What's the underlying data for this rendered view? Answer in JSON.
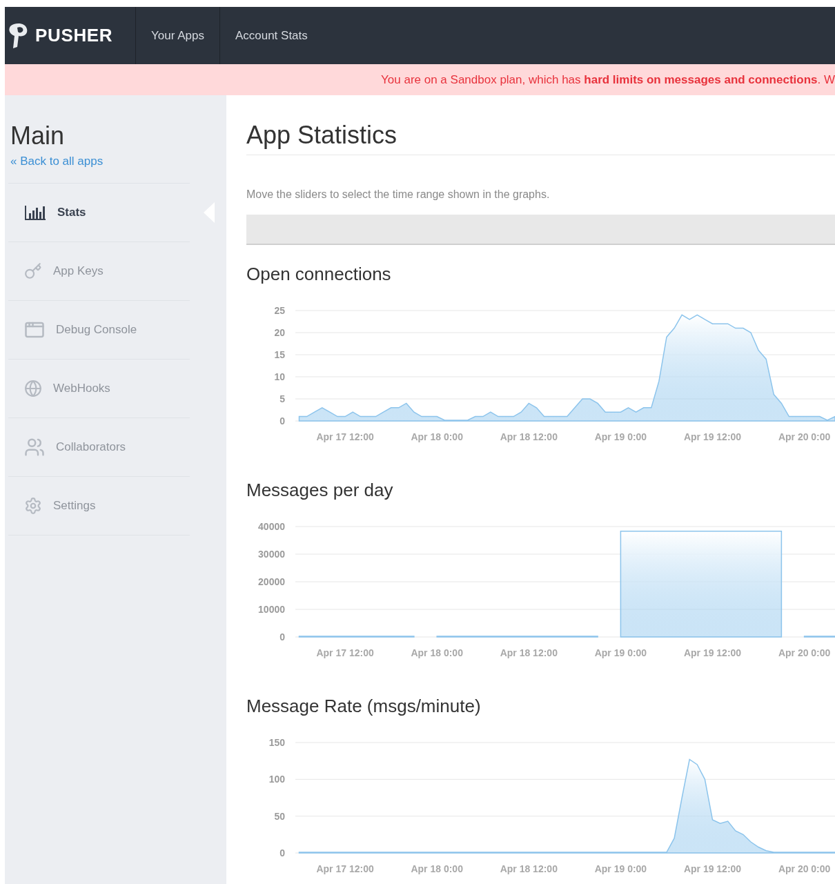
{
  "nav": {
    "brand": "PUSHER",
    "items": [
      {
        "label": "Your Apps",
        "selected": false
      },
      {
        "label": "Account Stats",
        "selected": false
      }
    ]
  },
  "banner": {
    "text": "You are on a Sandbox plan, which has **hard limits on messages and connections**. W"
  },
  "sidebar": {
    "title": "Main",
    "back_link": "« Back to all apps",
    "items": [
      {
        "label": "Stats",
        "kind": "stats",
        "selected": true
      },
      {
        "label": "App Keys",
        "kind": "keys",
        "selected": false
      },
      {
        "label": "Debug Console",
        "kind": "console",
        "selected": false
      },
      {
        "label": "WebHooks",
        "kind": "webhooks",
        "selected": false
      },
      {
        "label": "Collaborators",
        "kind": "collaborators",
        "selected": false
      },
      {
        "label": "Settings",
        "kind": "settings",
        "selected": false
      }
    ]
  },
  "main": {
    "title": "App Statistics",
    "hint": "Move the sliders to select the time range shown in the graphs.",
    "charts": [
      {
        "title": "Open connections",
        "chart_data": {
          "type": "area",
          "categories": [
            null,
            null,
            null,
            null,
            null,
            null,
            "Apr 17 12:00",
            null,
            null,
            null,
            null,
            null,
            null,
            null,
            null,
            null,
            null,
            null,
            "Apr 18 0:00",
            null,
            null,
            null,
            null,
            null,
            null,
            null,
            null,
            null,
            null,
            null,
            "Apr 18 12:00",
            null,
            null,
            null,
            null,
            null,
            null,
            null,
            null,
            null,
            null,
            null,
            "Apr 19 0:00",
            null,
            null,
            null,
            null,
            null,
            null,
            null,
            null,
            null,
            null,
            null,
            "Apr 19 12:00",
            null,
            null,
            null,
            null,
            null,
            null,
            null,
            null,
            null,
            null,
            null,
            "Apr 20 0:00",
            null,
            null,
            null,
            null
          ],
          "series": [
            {
              "color": "#8cc4ec",
              "values": [
                1,
                1,
                2,
                3,
                2,
                1,
                1,
                2,
                1,
                1,
                1,
                2,
                3,
                3,
                4,
                2,
                1,
                1,
                1,
                0,
                0,
                0,
                0,
                1,
                1,
                2,
                1,
                1,
                1,
                2,
                4,
                3,
                1,
                1,
                1,
                1,
                3,
                5,
                5,
                4,
                2,
                2,
                2,
                3,
                2,
                3,
                3,
                9,
                19,
                21,
                24,
                23,
                24,
                23,
                22,
                22,
                22,
                21,
                21,
                20,
                16,
                14,
                6,
                4,
                1,
                1,
                1,
                1,
                1,
                0,
                1
              ]
            }
          ],
          "grid": true,
          "ylim": [
            0,
            25
          ],
          "yticks": [
            0,
            5,
            10,
            15,
            20,
            25
          ]
        }
      },
      {
        "title": "Messages per day",
        "chart_data": {
          "type": "area",
          "categories": [
            null,
            null,
            null,
            null,
            null,
            null,
            "Apr 17 12:00",
            null,
            null,
            null,
            null,
            null,
            null,
            null,
            null,
            null,
            null,
            null,
            "Apr 18 0:00",
            null,
            null,
            null,
            null,
            null,
            null,
            null,
            null,
            null,
            null,
            null,
            "Apr 18 12:00",
            null,
            null,
            null,
            null,
            null,
            null,
            null,
            null,
            null,
            null,
            null,
            "Apr 19 0:00",
            null,
            null,
            null,
            null,
            null,
            null,
            null,
            null,
            null,
            null,
            null,
            "Apr 19 12:00",
            null,
            null,
            null,
            null,
            null,
            null,
            null,
            null,
            null,
            null,
            null,
            "Apr 20 0:00",
            null,
            null,
            null,
            null
          ],
          "series": [
            {
              "color": "#8cc4ec",
              "values": [
                0,
                0,
                0,
                0,
                0,
                0,
                0,
                0,
                0,
                0,
                0,
                0,
                0,
                0,
                0,
                0,
                null,
                null,
                0,
                0,
                0,
                0,
                0,
                0,
                0,
                0,
                0,
                0,
                0,
                0,
                0,
                0,
                0,
                0,
                0,
                0,
                0,
                0,
                0,
                0,
                null,
                null,
                38300,
                38300,
                38300,
                38300,
                38300,
                38300,
                38300,
                38300,
                38300,
                38300,
                38300,
                38300,
                38300,
                38300,
                38300,
                38300,
                38300,
                38300,
                38300,
                38300,
                38300,
                38300,
                null,
                null,
                0,
                0,
                0,
                0,
                0
              ]
            }
          ],
          "grid": true,
          "ylim": [
            0,
            40000
          ],
          "yticks": [
            0,
            10000,
            20000,
            30000,
            40000
          ]
        }
      },
      {
        "title": "Message Rate (msgs/minute)",
        "chart_data": {
          "type": "area",
          "categories": [
            null,
            null,
            null,
            null,
            null,
            null,
            "Apr 17 12:00",
            null,
            null,
            null,
            null,
            null,
            null,
            null,
            null,
            null,
            null,
            null,
            "Apr 18 0:00",
            null,
            null,
            null,
            null,
            null,
            null,
            null,
            null,
            null,
            null,
            null,
            "Apr 18 12:00",
            null,
            null,
            null,
            null,
            null,
            null,
            null,
            null,
            null,
            null,
            null,
            "Apr 19 0:00",
            null,
            null,
            null,
            null,
            null,
            null,
            null,
            null,
            null,
            null,
            null,
            "Apr 19 12:00",
            null,
            null,
            null,
            null,
            null,
            null,
            null,
            null,
            null,
            null,
            null,
            "Apr 20 0:00",
            null,
            null,
            null,
            null
          ],
          "series": [
            {
              "color": "#8cc4ec",
              "values": [
                0,
                0,
                0,
                0,
                0,
                0,
                0,
                0,
                0,
                0,
                0,
                0,
                0,
                0,
                0,
                0,
                0,
                0,
                0,
                0,
                0,
                0,
                0,
                0,
                0,
                0,
                0,
                0,
                0,
                0,
                0,
                0,
                0,
                0,
                0,
                0,
                0,
                0,
                0,
                0,
                0,
                0,
                0,
                0,
                0,
                0,
                0,
                0,
                0,
                20,
                75,
                127,
                120,
                100,
                45,
                40,
                43,
                30,
                25,
                15,
                8,
                3,
                0,
                0,
                0,
                0,
                0,
                0,
                0,
                0,
                0
              ]
            }
          ],
          "grid": true,
          "ylim": [
            0,
            150
          ],
          "yticks": [
            0,
            50,
            100,
            150
          ]
        }
      }
    ]
  }
}
